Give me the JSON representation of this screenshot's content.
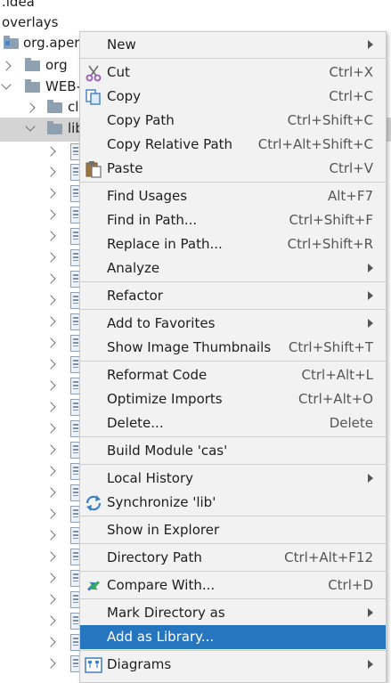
{
  "tree": {
    "idea_label": ".idea",
    "overlays_label": "overlays",
    "module_label": "org.aper",
    "org_label": "org",
    "webinf_label": "WEB-",
    "classes_label": "cl",
    "lib_label": "lib"
  },
  "menu": {
    "items": [
      {
        "label": "New",
        "shortcut": ""
      },
      {
        "label": "Cut",
        "shortcut": "Ctrl+X"
      },
      {
        "label": "Copy",
        "shortcut": "Ctrl+C"
      },
      {
        "label": "Copy Path",
        "shortcut": "Ctrl+Shift+C"
      },
      {
        "label": "Copy Relative Path",
        "shortcut": "Ctrl+Alt+Shift+C"
      },
      {
        "label": "Paste",
        "shortcut": "Ctrl+V"
      },
      {
        "label": "Find Usages",
        "shortcut": "Alt+F7"
      },
      {
        "label": "Find in Path...",
        "shortcut": "Ctrl+Shift+F"
      },
      {
        "label": "Replace in Path...",
        "shortcut": "Ctrl+Shift+R"
      },
      {
        "label": "Analyze",
        "shortcut": ""
      },
      {
        "label": "Refactor",
        "shortcut": ""
      },
      {
        "label": "Add to Favorites",
        "shortcut": ""
      },
      {
        "label": "Show Image Thumbnails",
        "shortcut": "Ctrl+Shift+T"
      },
      {
        "label": "Reformat Code",
        "shortcut": "Ctrl+Alt+L"
      },
      {
        "label": "Optimize Imports",
        "shortcut": "Ctrl+Alt+O"
      },
      {
        "label": "Delete...",
        "shortcut": "Delete"
      },
      {
        "label": "Build Module 'cas'",
        "shortcut": ""
      },
      {
        "label": "Local History",
        "shortcut": ""
      },
      {
        "label": "Synchronize 'lib'",
        "shortcut": ""
      },
      {
        "label": "Show in Explorer",
        "shortcut": ""
      },
      {
        "label": "Directory Path",
        "shortcut": "Ctrl+Alt+F12"
      },
      {
        "label": "Compare With...",
        "shortcut": "Ctrl+D"
      },
      {
        "label": "Mark Directory as",
        "shortcut": ""
      },
      {
        "label": "Add as Library...",
        "shortcut": ""
      },
      {
        "label": "Diagrams",
        "shortcut": ""
      }
    ]
  },
  "colors": {
    "highlight": "#2675bf",
    "menu_bg": "#f2f2f2",
    "tree_selection": "#d4d4d4"
  }
}
